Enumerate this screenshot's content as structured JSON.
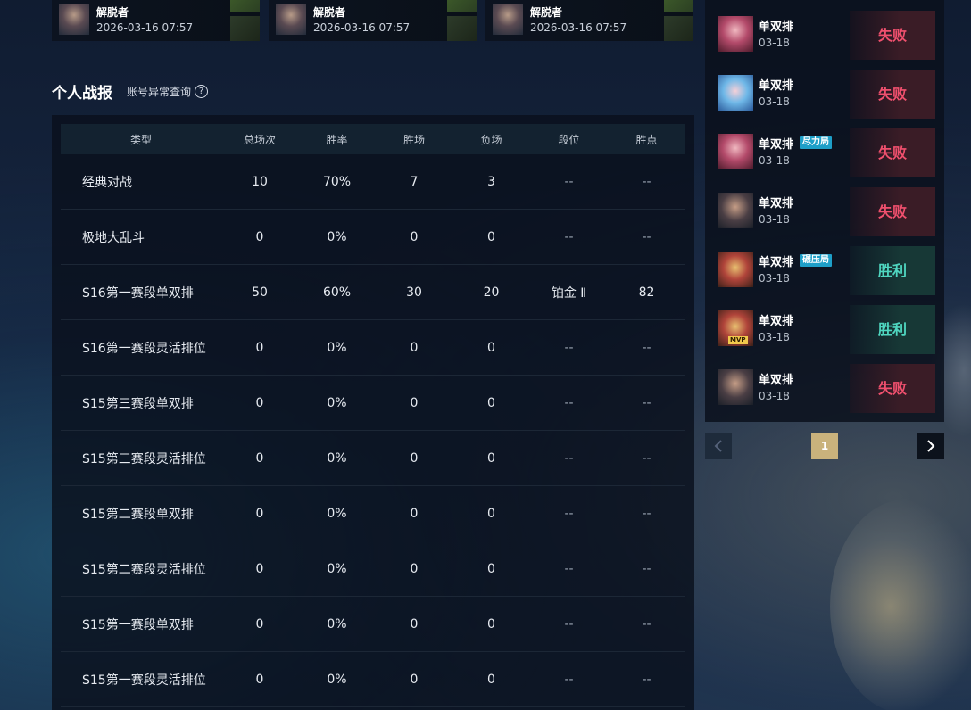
{
  "top_cards": [
    {
      "name": "解脱者",
      "time": "2026-03-16 07:57"
    },
    {
      "name": "解脱者",
      "time": "2026-03-16 07:57"
    },
    {
      "name": "解脱者",
      "time": "2026-03-16 07:57"
    }
  ],
  "section": {
    "title": "个人战报",
    "link_label": "账号异常查询",
    "help_glyph": "?"
  },
  "stats": {
    "headers": [
      "类型",
      "总场次",
      "胜率",
      "胜场",
      "负场",
      "段位",
      "胜点"
    ],
    "rows": [
      {
        "type": "经典对战",
        "total": "10",
        "rate": "70%",
        "wins": "7",
        "losses": "3",
        "rank": "--",
        "lp": "--"
      },
      {
        "type": "极地大乱斗",
        "total": "0",
        "rate": "0%",
        "wins": "0",
        "losses": "0",
        "rank": "--",
        "lp": "--"
      },
      {
        "type": "S16第一赛段单双排",
        "total": "50",
        "rate": "60%",
        "wins": "30",
        "losses": "20",
        "rank": "铂金 Ⅱ",
        "lp": "82"
      },
      {
        "type": "S16第一赛段灵活排位",
        "total": "0",
        "rate": "0%",
        "wins": "0",
        "losses": "0",
        "rank": "--",
        "lp": "--"
      },
      {
        "type": "S15第三赛段单双排",
        "total": "0",
        "rate": "0%",
        "wins": "0",
        "losses": "0",
        "rank": "--",
        "lp": "--"
      },
      {
        "type": "S15第三赛段灵活排位",
        "total": "0",
        "rate": "0%",
        "wins": "0",
        "losses": "0",
        "rank": "--",
        "lp": "--"
      },
      {
        "type": "S15第二赛段单双排",
        "total": "0",
        "rate": "0%",
        "wins": "0",
        "losses": "0",
        "rank": "--",
        "lp": "--"
      },
      {
        "type": "S15第二赛段灵活排位",
        "total": "0",
        "rate": "0%",
        "wins": "0",
        "losses": "0",
        "rank": "--",
        "lp": "--"
      },
      {
        "type": "S15第一赛段单双排",
        "total": "0",
        "rate": "0%",
        "wins": "0",
        "losses": "0",
        "rank": "--",
        "lp": "--"
      },
      {
        "type": "S15第一赛段灵活排位",
        "total": "0",
        "rate": "0%",
        "wins": "0",
        "losses": "0",
        "rank": "--",
        "lp": "--"
      }
    ]
  },
  "matches": [
    {
      "mode": "单双排",
      "date": "03-18",
      "result": "失败",
      "win": false,
      "tag": "",
      "mvp": "",
      "avatar": "pink"
    },
    {
      "mode": "单双排",
      "date": "03-18",
      "result": "失败",
      "win": false,
      "tag": "",
      "mvp": "",
      "avatar": "blue"
    },
    {
      "mode": "单双排",
      "date": "03-18",
      "result": "失败",
      "win": false,
      "tag": "尽力局",
      "mvp": "",
      "avatar": "pink"
    },
    {
      "mode": "单双排",
      "date": "03-18",
      "result": "失败",
      "win": false,
      "tag": "",
      "mvp": "",
      "avatar": "dark"
    },
    {
      "mode": "单双排",
      "date": "03-18",
      "result": "胜利",
      "win": true,
      "tag": "碾压局",
      "mvp": "",
      "avatar": "red"
    },
    {
      "mode": "单双排",
      "date": "03-18",
      "result": "胜利",
      "win": true,
      "tag": "",
      "mvp": "MVP",
      "avatar": "red"
    },
    {
      "mode": "单双排",
      "date": "03-18",
      "result": "失败",
      "win": false,
      "tag": "",
      "mvp": "",
      "avatar": "dark"
    }
  ],
  "pager": {
    "current_page": "1"
  }
}
